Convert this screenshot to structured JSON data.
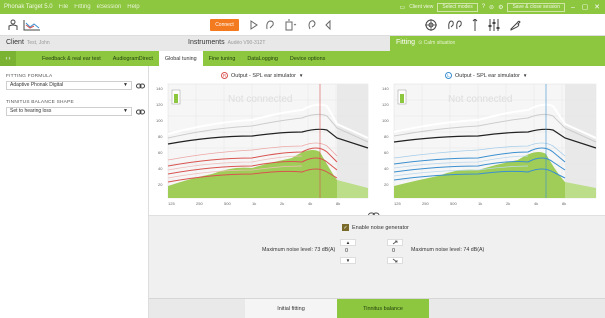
{
  "titlebar": {
    "app_name": "Phonak Target 5.0",
    "menu": [
      "File",
      "Fitting",
      "eSession",
      "Help"
    ],
    "client_view": "Client view",
    "select_modes": "Select modes",
    "save_close": "Save & close session",
    "min": "–",
    "max": "▢",
    "close": "✕"
  },
  "toolbar": {
    "connect_label": "Connect"
  },
  "info": {
    "client_label": "Client",
    "client_name": "Test, John",
    "instruments_label": "Instruments",
    "instruments_model": "Audéo V90-312T",
    "fitting_label": "Fitting",
    "fitting_situation": "Calm situation"
  },
  "tabs": [
    "Feedback & real ear test",
    "AudiogramDirect",
    "Global tuning",
    "Fine tuning",
    "DataLogging",
    "Device options"
  ],
  "active_tab": "Global tuning",
  "left": {
    "formula_label": "FITTING FORMULA",
    "formula_value": "Adaptive Phonak Digital",
    "tinnitus_label": "TINNITUS BALANCE SHAPE",
    "tinnitus_value": "Set to hearing loss"
  },
  "right_output": "Output - SPL ear simulator",
  "left_output": "Output - SPL ear simulator",
  "right_ear_letter": "R",
  "left_ear_letter": "L",
  "not_connected": "Not connected",
  "y_ticks": [
    "140",
    "120",
    "100",
    "80",
    "60",
    "40",
    "20"
  ],
  "x_ticks": [
    "125",
    "250",
    "500",
    "1k",
    "2k",
    "4k",
    "8k"
  ],
  "noise": {
    "enable_label": "Enable noise generator",
    "right_value": "0",
    "left_value": "0",
    "right_max": "Maximum noise level: 73 dB(A)",
    "left_max": "Maximum noise level: 74 dB(A)"
  },
  "bottom_tabs": [
    "Initial fitting",
    "Tinnitus balance"
  ],
  "active_bottom_tab": "Tinnitus balance",
  "colors": {
    "green": "#8dc63f",
    "orange": "#f47a20",
    "red": "#d9534f",
    "blue": "#3a8fd0"
  }
}
